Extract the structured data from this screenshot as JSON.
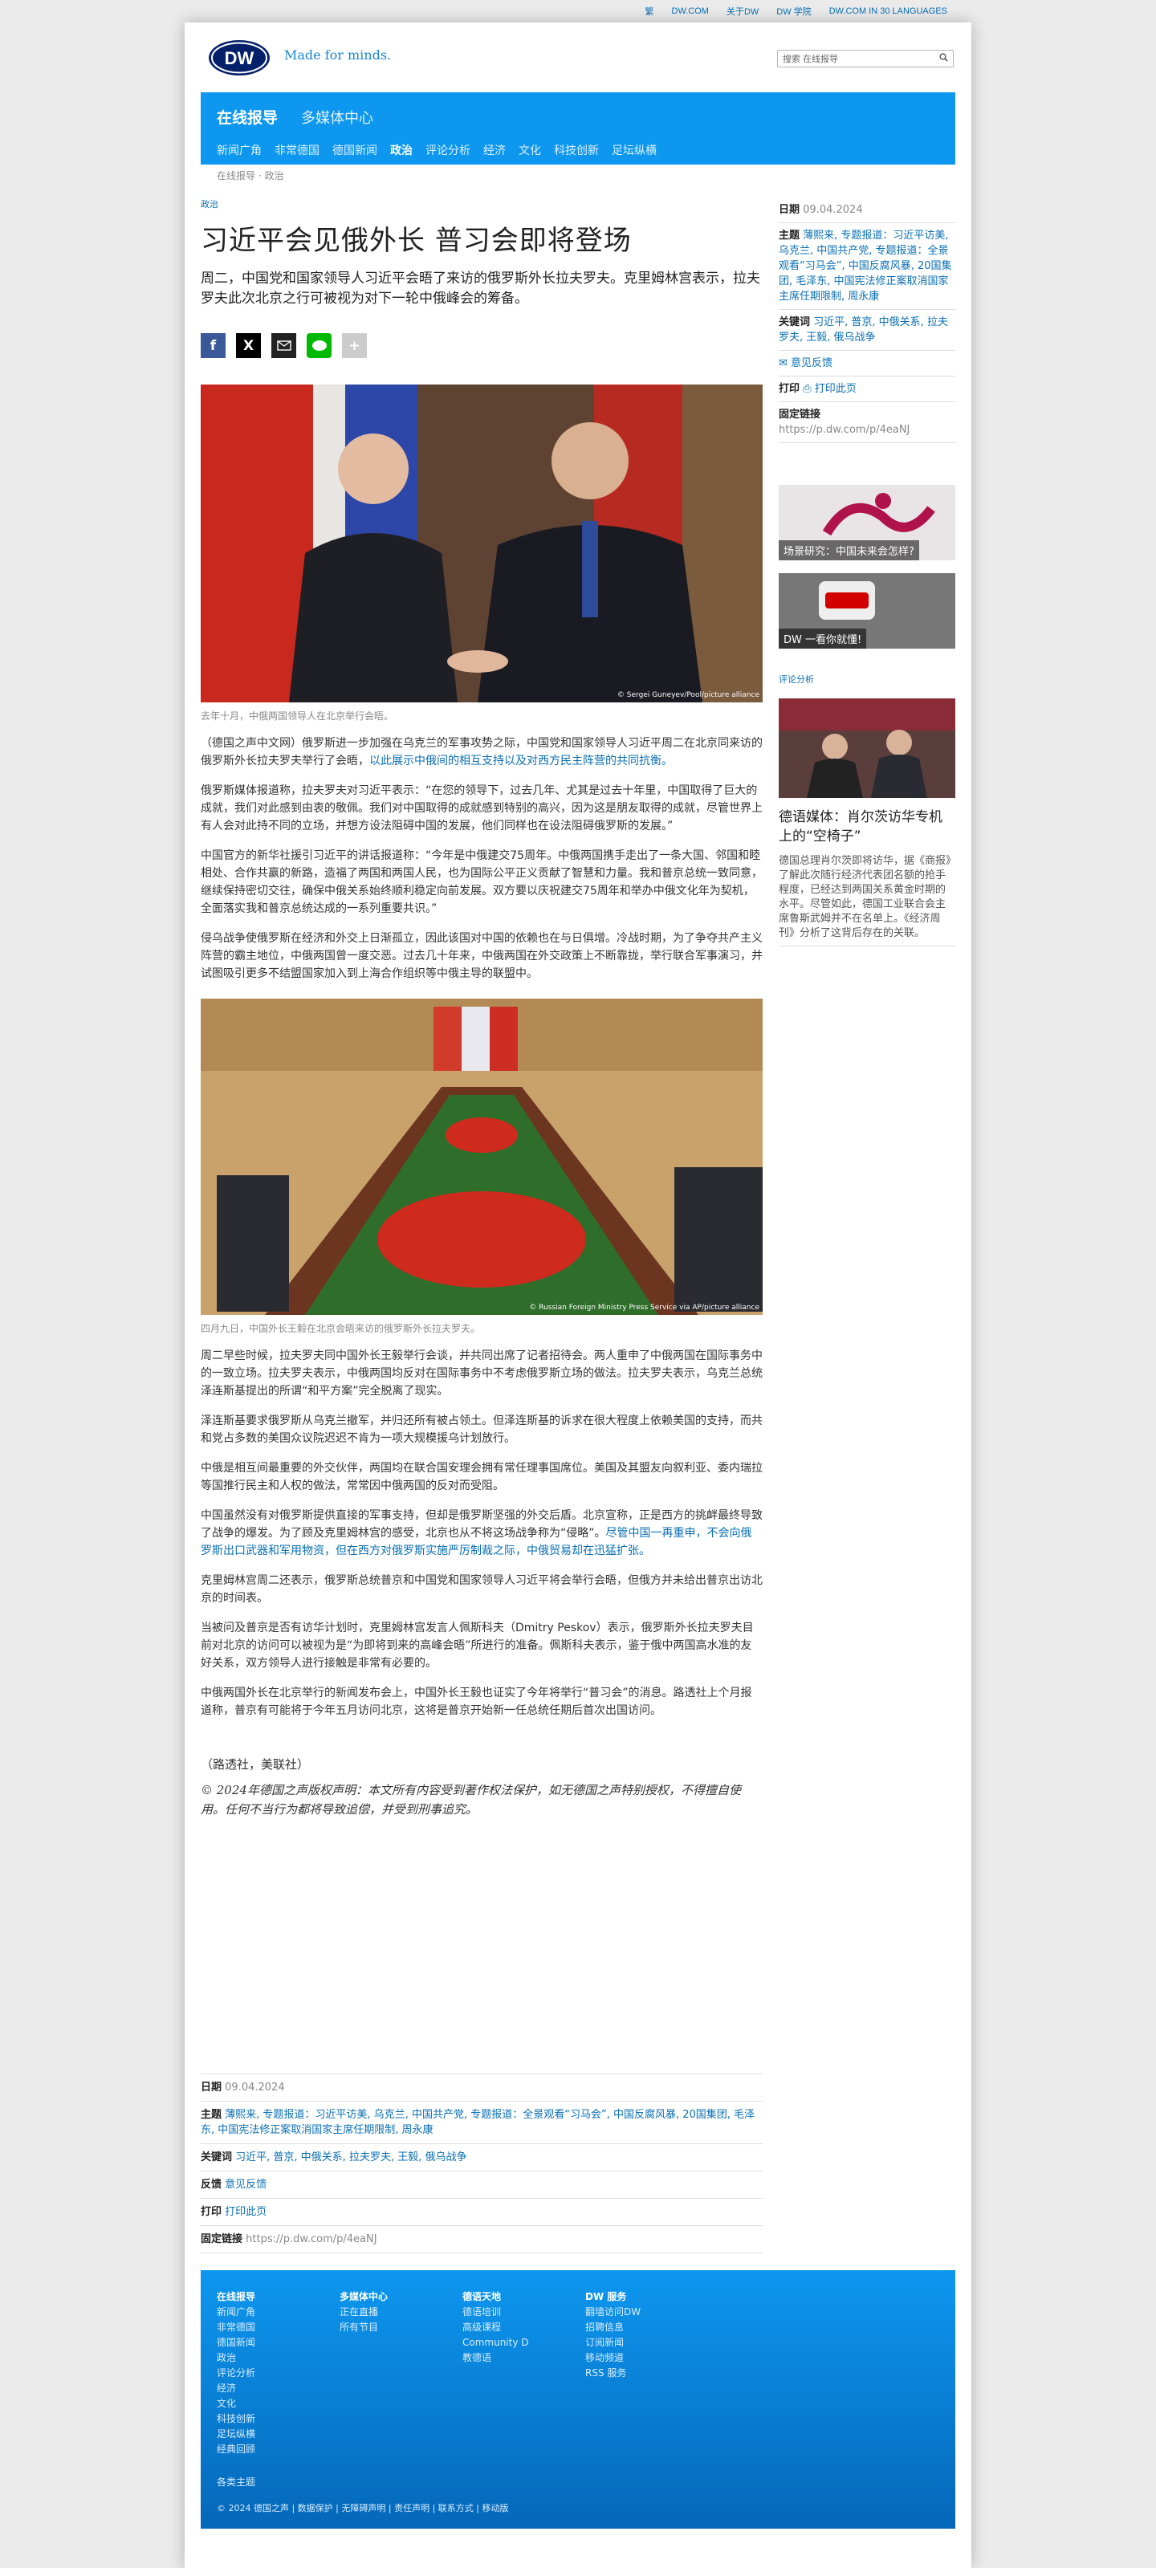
{
  "topbar": {
    "links": [
      "繁",
      "DW.COM",
      "关于DW",
      "DW 学院",
      "DW.COM IN 30 LANGUAGES"
    ]
  },
  "header": {
    "logo_text": "DW",
    "slogan": "Made for minds.",
    "search_placeholder": "搜索 在线报导"
  },
  "nav": {
    "primary": "在线报导",
    "secondary": "多媒体中心",
    "sub": [
      "新闻广角",
      "非常德国",
      "德国新闻",
      "政治",
      "评论分析",
      "经济",
      "文化",
      "科技创新",
      "足坛纵横"
    ],
    "active": "政治"
  },
  "breadcrumb": "在线报导 · 政治",
  "article": {
    "category": "政治",
    "title": "习近平会见俄外长 普习会即将登场",
    "lead": "周二，中国党和国家领导人习近平会晤了来访的俄罗斯外长拉夫罗夫。克里姆林宫表示，拉夫罗夫此次北京之行可被视为对下一轮中俄峰会的筹备。",
    "photo1": {
      "credit": "© Sergei Guneyev/Pool/picture alliance",
      "caption": "去年十月，中俄两国领导人在北京举行会晤。"
    },
    "p1a": "（德国之声中文网）俄罗斯进一步加强在乌克兰的军事攻势之际，中国党和国家领导人习近平周二在北京同来访的俄罗斯外长拉夫罗夫举行了会晤，",
    "p1b": "以此展示中俄间的相互支持以及对西方民主阵营的共同抗衡。",
    "p2": "俄罗斯媒体报道称，拉夫罗夫对习近平表示：“在您的领导下，过去几年、尤其是过去十年里，中国取得了巨大的成就，我们对此感到由衷的敬佩。我们对中国取得的成就感到特别的高兴，因为这是朋友取得的成就，尽管世界上有人会对此持不同的立场，并想方设法阻碍中国的发展，他们同样也在设法阻碍俄罗斯的发展。”",
    "p3": "中国官方的新华社援引习近平的讲话报道称：“今年是中俄建交75周年。中俄两国携手走出了一条大国、邻国和睦相处、合作共赢的新路，造福了两国和两国人民，也为国际公平正义贡献了智慧和力量。我和普京总统一致同意，继续保持密切交往，确保中俄关系始终顺利稳定向前发展。双方要以庆祝建交75周年和举办中俄文化年为契机，全面落实我和普京总统达成的一系列重要共识。”",
    "p4": "侵乌战争使俄罗斯在经济和外交上日渐孤立，因此该国对中国的依赖也在与日俱增。冷战时期，为了争夺共产主义阵营的霸主地位，中俄两国曾一度交恶。过去几十年来，中俄两国在外交政策上不断靠拢，举行联合军事演习，并试图吸引更多不结盟国家加入到上海合作组织等中俄主导的联盟中。",
    "photo2": {
      "credit": "© Russian Foreign Ministry Press Service via AP/picture alliance",
      "caption": "四月九日，中国外长王毅在北京会晤来访的俄罗斯外长拉夫罗夫。"
    },
    "p5": "周二早些时候，拉夫罗夫同中国外长王毅举行会谈，并共同出席了记者招待会。两人重申了中俄两国在国际事务中的一致立场。拉夫罗夫表示，中俄两国均反对在国际事务中不考虑俄罗斯立场的做法。拉夫罗夫表示，乌克兰总统泽连斯基提出的所谓“和平方案”完全脱离了现实。",
    "p6": "泽连斯基要求俄罗斯从乌克兰撤军，并归还所有被占领土。但泽连斯基的诉求在很大程度上依赖美国的支持，而共和党占多数的美国众议院迟迟不肯为一项大规模援乌计划放行。",
    "p7": "中俄是相互间最重要的外交伙伴，两国均在联合国安理会拥有常任理事国席位。美国及其盟友向叙利亚、委内瑞拉等国推行民主和人权的做法，常常因中俄两国的反对而受阻。",
    "p8a": "中国虽然没有对俄罗斯提供直接的军事支持，但却是俄罗斯坚强的外交后盾。北京宣称，正是西方的挑衅最终导致了战争的爆发。为了顾及克里姆林宫的感受，北京也从不将这场战争称为“侵略”。",
    "p8b": "尽管中国一再重申，不会向俄罗斯出口武器和军用物资，但在西方对俄罗斯实施严厉制裁之际，中俄贸易却在迅猛扩张。",
    "p9": "克里姆林宫周二还表示，俄罗斯总统普京和中国党和国家领导人习近平将会举行会晤，但俄方并未给出普京出访北京的时间表。",
    "p10": "当被问及普京是否有访华计划时，克里姆林宫发言人佩斯科夫（Dmitry Peskov）表示，俄罗斯外长拉夫罗夫目前对北京的访问可以被视为是“为即将到来的高峰会晤”所进行的准备。佩斯科夫表示，鉴于俄中两国高水准的友好关系，双方领导人进行接触是非常有必要的。",
    "p11": "中俄两国外长在北京举行的新闻发布会上，中国外长王毅也证实了今年将举行“普习会”的消息。路透社上个月报道称，普京有可能将于今年五月访问北京，这将是普京开始新一任总统任期后首次出国访问。",
    "signature": "（路透社，美联社）",
    "copyright": "© 2024年德国之声版权声明：本文所有内容受到著作权法保护，如无德国之声特别授权，不得擅自使用。任何不当行为都将导致追偿，并受到刑事追究。"
  },
  "meta": {
    "date_label": "日期",
    "date": "09.04.2024",
    "topics_label": "主题",
    "topics": "薄熙来, 专题报道：习近平访美, 乌克兰, 中国共产党, 专题报道：全景观看“习马会”, 中国反腐风暴, 20国集团, 毛泽东, 中国宪法修正案取消国家主席任期限制, 周永康",
    "keywords_label": "关键词",
    "keywords": "习近平, 普京, 中俄关系, 拉夫罗夫, 王毅, 俄乌战争",
    "feedback_label": "反馈",
    "feedback": "意见反馈",
    "print_label": "打印",
    "print": "打印此页",
    "permalink_label": "固定链接",
    "permalink": "https://p.dw.com/p/4eaNJ"
  },
  "sidebar": {
    "date_label": "日期",
    "date": "09.04.2024",
    "topics_label": "主题",
    "topics": "薄熙来, 专题报道：习近平访美, 乌克兰, 中国共产党, 专题报道：全景观看“习马会”, 中国反腐风暴, 20国集团, 毛泽东, 中国宪法修正案取消国家主席任期限制, 周永康",
    "keywords_label": "关键词",
    "keywords": "习近平, 普京, 中俄关系, 拉夫罗夫, 王毅, 俄乌战争",
    "feedback": "意见反馈",
    "print_label": "打印",
    "print": "打印此页",
    "permalink_label": "固定链接",
    "permalink": "https://p.dw.com/p/4eaNJ",
    "thumb1": "场景研究：中国未来会怎样?",
    "thumb2": "DW 一看你就懂!",
    "analysis_label": "评论分析",
    "analysis_title": "德语媒体：肖尔茨访华专机上的“空椅子”",
    "analysis_text": "德国总理肖尔茨即将访华，据《商报》了解此次随行经济代表团名额的抢手程度，已经达到两国关系黄金时期的水平。尽管如此，德国工业联合会主席鲁斯武姆并不在名单上。《经济周刊》分析了这背后存在的关联。"
  },
  "footer": {
    "col1": {
      "title": "在线报导",
      "items": [
        "新闻广角",
        "非常德国",
        "德国新闻",
        "政治",
        "评论分析",
        "经济",
        "文化",
        "科技创新",
        "足坛纵横",
        "经典回顾"
      ]
    },
    "col2": {
      "title": "多媒体中心",
      "items": [
        "正在直播",
        "所有节目"
      ]
    },
    "col3": {
      "title": "德语天地",
      "items": [
        "德语培训",
        "高级课程",
        "Community D",
        "教德语"
      ]
    },
    "col4": {
      "title": "DW 服务",
      "items": [
        "翻墙访问DW",
        "招聘信息",
        "订阅新闻",
        "移动频道",
        "RSS 服务"
      ]
    },
    "topics": "各类主题",
    "bottom": "© 2024 德国之声 | 数据保护 | 无障碍声明 | 责任声明 | 联系方式 | 移动版"
  },
  "colors": {
    "brand": "#0d97ef",
    "link": "#0a6fb3",
    "dark_blue": "#05206b"
  },
  "icons": [
    "dw-logo",
    "search-icon",
    "facebook-icon",
    "x-icon",
    "email-icon",
    "line-icon",
    "plus-icon",
    "feedback-icon",
    "print-icon"
  ]
}
